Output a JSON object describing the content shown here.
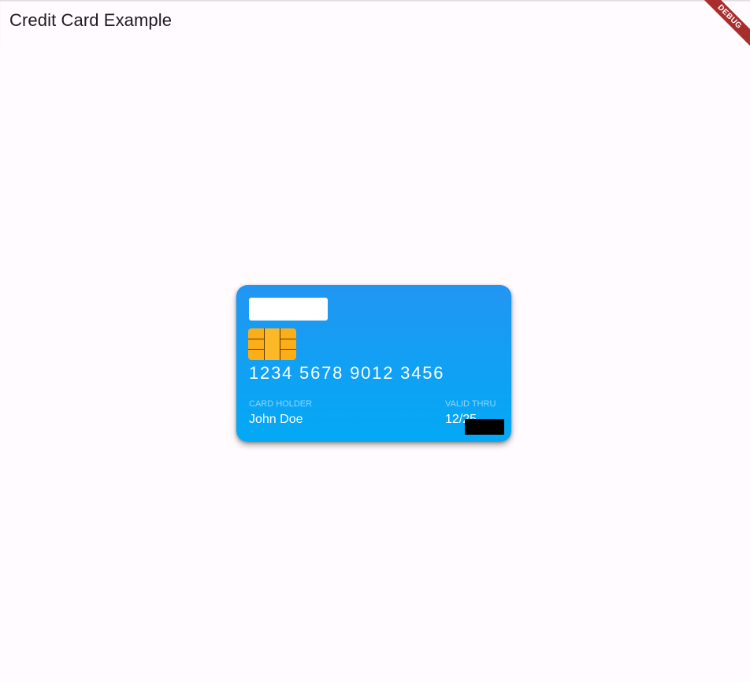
{
  "app_bar": {
    "title": "Credit Card Example"
  },
  "debug_banner": {
    "label": "DEBUG"
  },
  "card": {
    "number": "1234 5678 9012 3456",
    "holder_label": "CARD HOLDER",
    "holder_name": "John Doe",
    "valid_label": "VALID THRU",
    "valid_date": "12/25",
    "colors": {
      "gradient_top": "#2196f3",
      "gradient_bottom": "#03a9f4",
      "chip": "#fbae17"
    }
  }
}
